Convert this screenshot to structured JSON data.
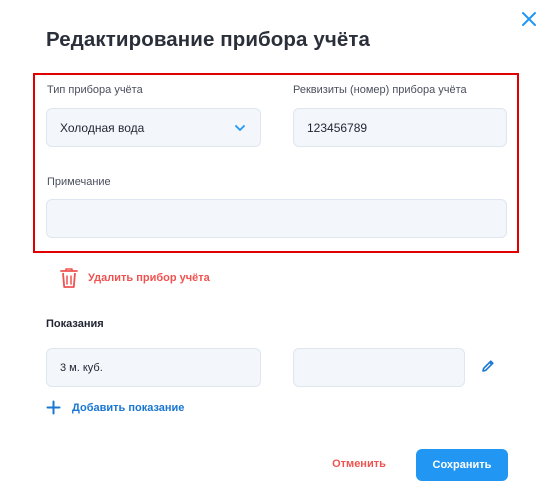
{
  "dialog": {
    "title": "Редактирование прибора учёта",
    "close_icon": "close-icon"
  },
  "form": {
    "meter_type": {
      "label": "Тип прибора учёта",
      "value": "Холодная вода",
      "icon": "chevron-down-icon"
    },
    "requisites": {
      "label": "Реквизиты (номер) прибора учёта",
      "value": "123456789"
    },
    "note": {
      "label": "Примечание",
      "value": "",
      "placeholder": ""
    }
  },
  "delete": {
    "label": "Удалить прибор учёта",
    "icon": "trash-icon"
  },
  "readings": {
    "title": "Показания",
    "items": [
      {
        "value": "3 м. куб."
      },
      {
        "value": ""
      }
    ],
    "edit_icon": "pencil-icon",
    "add_label": "Добавить показание",
    "add_icon": "plus-icon"
  },
  "actions": {
    "cancel_label": "Отменить",
    "save_label": "Сохранить"
  },
  "colors": {
    "accent": "#2196f3",
    "link": "#1976d2",
    "danger": "#ef5350",
    "field_bg": "#f3f7fc",
    "highlight": "#e00000"
  }
}
